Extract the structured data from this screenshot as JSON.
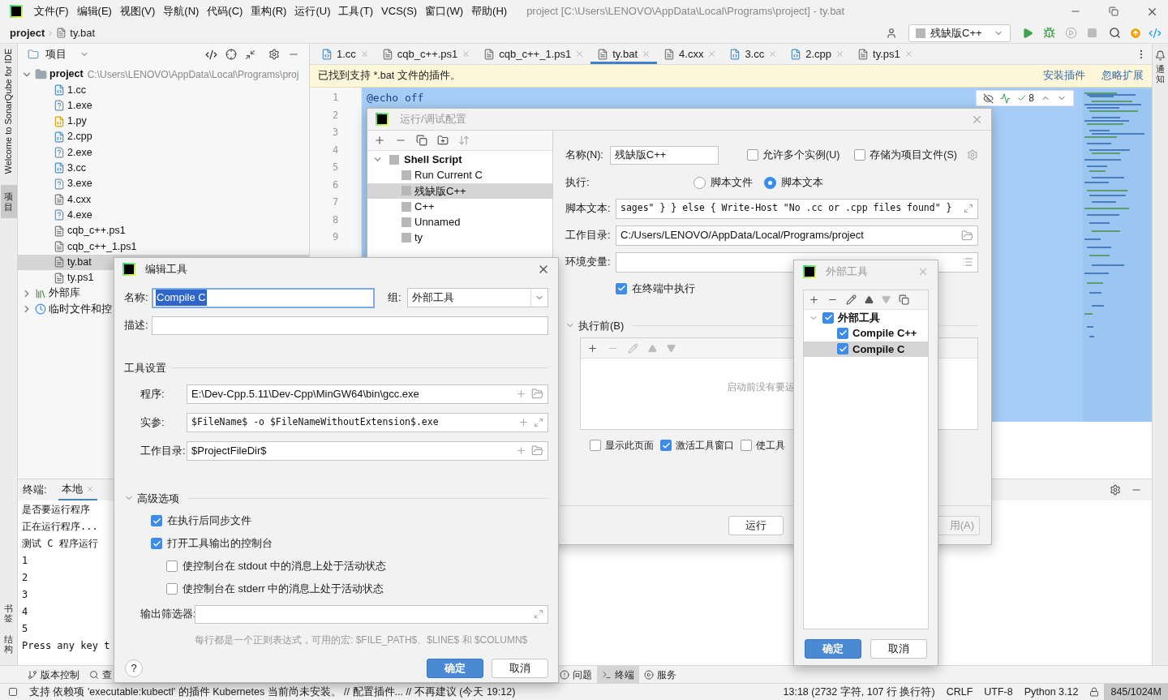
{
  "window": {
    "title": "project [C:\\Users\\LENOVO\\AppData\\Local\\Programs\\project] - ty.bat"
  },
  "menu": [
    "文件(F)",
    "编辑(E)",
    "视图(V)",
    "导航(N)",
    "代码(C)",
    "重构(R)",
    "运行(U)",
    "工具(T)",
    "VCS(S)",
    "窗口(W)",
    "帮助(H)"
  ],
  "breadcrumb": [
    "project",
    "ty.bat"
  ],
  "toolbar": {
    "run_config": "残缺版C++"
  },
  "left_strip": [
    {
      "label": "Welcome to SonarQube for IDE",
      "selected": false
    },
    {
      "label": "项目",
      "selected": true
    }
  ],
  "left_strip_bottom": [
    "书签",
    "结构"
  ],
  "right_strip": [
    "通知"
  ],
  "project_panel": {
    "title": "项目",
    "tree": [
      {
        "name": "project",
        "path": "C:\\Users\\LENOVO\\AppData\\Local\\Programs\\proj",
        "kind": "folder",
        "expanded": true,
        "selected": false,
        "children": [
          {
            "name": "1.cc",
            "kind": "source",
            "selected": false
          },
          {
            "name": "1.exe",
            "kind": "unknown",
            "selected": false
          },
          {
            "name": "1.py",
            "kind": "python",
            "selected": false
          },
          {
            "name": "2.cpp",
            "kind": "source",
            "selected": false
          },
          {
            "name": "2.exe",
            "kind": "unknown",
            "selected": false
          },
          {
            "name": "3.cc",
            "kind": "source",
            "selected": false
          },
          {
            "name": "3.exe",
            "kind": "unknown",
            "selected": false
          },
          {
            "name": "4.cxx",
            "kind": "text",
            "selected": false
          },
          {
            "name": "4.exe",
            "kind": "unknown",
            "selected": false
          },
          {
            "name": "cqb_c++.ps1",
            "kind": "text",
            "selected": false
          },
          {
            "name": "cqb_c++_1.ps1",
            "kind": "text",
            "selected": false
          },
          {
            "name": "ty.bat",
            "kind": "text",
            "selected": true
          },
          {
            "name": "ty.ps1",
            "kind": "text",
            "selected": false
          }
        ]
      },
      {
        "name": "外部库",
        "kind": "library",
        "expanded": false,
        "selected": false
      },
      {
        "name": "临时文件和控",
        "kind": "scratch",
        "expanded": false,
        "selected": false
      }
    ]
  },
  "editor": {
    "tabs": [
      {
        "label": "1.cc",
        "kind": "source",
        "selected": false
      },
      {
        "label": "cqb_c++.ps1",
        "kind": "text",
        "selected": false
      },
      {
        "label": "cqb_c++_1.ps1",
        "kind": "text",
        "selected": false
      },
      {
        "label": "ty.bat",
        "kind": "text",
        "selected": true
      },
      {
        "label": "4.cxx",
        "kind": "text",
        "selected": false
      },
      {
        "label": "3.cc",
        "kind": "source",
        "selected": false
      },
      {
        "label": "2.cpp",
        "kind": "source",
        "selected": false
      },
      {
        "label": "ty.ps1",
        "kind": "text",
        "selected": false
      }
    ],
    "banner": {
      "text": "已找到支持 *.bat 文件的插件。",
      "actions": [
        "安装插件",
        "忽略扩展"
      ]
    },
    "line_numbers": [
      "1",
      "2",
      "3",
      "4",
      "5",
      "6",
      "7",
      "8",
      "9"
    ],
    "code": [
      "@echo off"
    ],
    "problems_count": "8"
  },
  "terminal": {
    "title": "终端:",
    "tabs": [
      {
        "label": "本地",
        "selected": true
      }
    ],
    "lines": [
      "是否要运行程序",
      "正在运行程序...",
      "测试 C 程序运行",
      "1",
      "2",
      "3",
      "4",
      "5",
      "Press any key t"
    ]
  },
  "tool_tabs": [
    {
      "label": "版本控制",
      "kind": "vcs",
      "selected": false
    },
    {
      "label": "查",
      "kind": "find",
      "selected": false
    },
    {
      "label": "问题",
      "kind": "problems",
      "selected": false
    },
    {
      "label": "终端",
      "kind": "terminal",
      "selected": true
    },
    {
      "label": "服务",
      "kind": "services",
      "selected": false
    }
  ],
  "status_bar": {
    "message": "支持 依赖项 'executable:kubectl' 的插件 Kubernetes 当前尚未安装。 // 配置插件... // 不再建议 (今天 19:12)",
    "items": [
      "13:18 (2732 字符, 107 行 换行符)",
      "CRLF",
      "UTF-8",
      "Python 3.12"
    ],
    "memory": "845/1024M"
  },
  "run_dialog": {
    "title": "运行/调试配置",
    "tree": [
      {
        "label": "Shell Script",
        "expanded": true,
        "selected": false,
        "children": [
          {
            "label": "Run Current C",
            "selected": false
          },
          {
            "label": "残缺版C++",
            "selected": true
          },
          {
            "label": "C++",
            "selected": false
          },
          {
            "label": "Unnamed",
            "selected": false
          },
          {
            "label": "ty",
            "selected": false
          }
        ]
      }
    ],
    "name_label": "名称(N):",
    "name": "残缺版C++",
    "options_top": [
      {
        "label": "允许多个实例(U)",
        "checked": false
      },
      {
        "label": "存储为项目文件(S)",
        "checked": false
      }
    ],
    "exec_label": "执行:",
    "exec_modes": [
      {
        "label": "脚本文件",
        "selected": false
      },
      {
        "label": "脚本文本",
        "selected": true
      }
    ],
    "fields": [
      {
        "label": "脚本文本:",
        "value": "sages\" } } else { Write-Host \"No .cc or .cpp files found\" }",
        "kind": "expand"
      },
      {
        "label": "工作目录:",
        "value": "C:/Users/LENOVO/AppData/Local/Programs/project",
        "kind": "folder"
      },
      {
        "label": "环境变量:",
        "kind": "list"
      }
    ],
    "run_in_terminal": {
      "label": "在终端中执行",
      "checked": true
    },
    "before_launch": {
      "label": "执行前(B)",
      "expanded": true,
      "hint": "启动前没有要运"
    },
    "options_bottom": [
      {
        "label": "显示此页面",
        "checked": false
      },
      {
        "label": "激活工具窗口",
        "checked": true
      },
      {
        "label": "使工具",
        "checked": false
      }
    ],
    "buttons": [
      "运行",
      "用(A)"
    ]
  },
  "edit_dialog": {
    "title": "编辑工具",
    "name_label": "名称:",
    "name": "Compile C",
    "group_label": "组:",
    "group": "外部工具",
    "description_label": "描述:",
    "section_tool": "工具设置",
    "fields": [
      {
        "label": "程序:",
        "value": "E:\\Dev-Cpp.5.11\\Dev-Cpp\\MinGW64\\bin\\gcc.exe",
        "kind": "folder"
      },
      {
        "label": "实参:",
        "value": "$FileName$ -o $FileNameWithoutExtension$.exe",
        "kind": "expand"
      },
      {
        "label": "工作目录:",
        "value": "$ProjectFileDir$",
        "kind": "folder"
      }
    ],
    "section_advanced": {
      "label": "高级选项",
      "expanded": true
    },
    "options": [
      {
        "label": "在执行后同步文件",
        "checked": true
      },
      {
        "label": "打开工具输出的控制台",
        "checked": true,
        "children": [
          {
            "label": "使控制台在 stdout 中的消息上处于活动状态",
            "checked": false
          },
          {
            "label": "使控制台在 stderr 中的消息上处于活动状态",
            "checked": false
          }
        ]
      }
    ],
    "filter_label": "输出筛选器:",
    "filter_hint": "每行都是一个正则表达式，可用的宏: $FILE_PATH$、$LINE$ 和 $COLUMN$",
    "help": "?",
    "buttons": [
      {
        "label": "确定",
        "kind": "primary"
      },
      {
        "label": "取消",
        "kind": "secondary"
      }
    ]
  },
  "external_tools_dialog": {
    "title": "外部工具",
    "tree": [
      {
        "label": "外部工具",
        "checked": true,
        "expanded": true,
        "selected": false,
        "children": [
          {
            "label": "Compile C++",
            "checked": true,
            "selected": false
          },
          {
            "label": "Compile C",
            "checked": true,
            "selected": true
          }
        ]
      }
    ],
    "buttons": [
      {
        "label": "确定",
        "kind": "primary"
      },
      {
        "label": "取消",
        "kind": "secondary"
      }
    ]
  }
}
